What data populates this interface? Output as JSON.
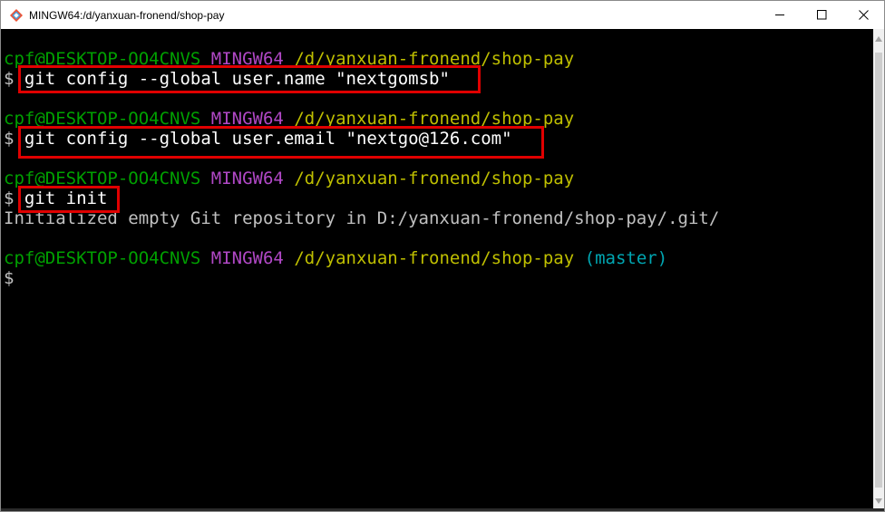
{
  "window": {
    "title": "MINGW64:/d/yanxuan-fronend/shop-pay",
    "icon": "git-bash-icon",
    "controls": [
      "minimize-icon",
      "maximize-icon",
      "close-icon"
    ]
  },
  "colors": {
    "user_host": "#00a000",
    "system": "#b148c6",
    "path": "#bfbf00",
    "branch": "#00a6b2",
    "highlight": "#e00000"
  },
  "terminal": {
    "blocks": [
      {
        "user_host": "cpf@DESKTOP-OO4CNVS",
        "system": "MINGW64",
        "path": "/d/yanxuan-fronend/shop-pay",
        "prompt": "$",
        "command": "git config --global user.name \"nextgomsb\""
      },
      {
        "user_host": "cpf@DESKTOP-OO4CNVS",
        "system": "MINGW64",
        "path": "/d/yanxuan-fronend/shop-pay",
        "prompt": "$",
        "command": "git config --global user.email \"nextgo@126.com\""
      },
      {
        "user_host": "cpf@DESKTOP-OO4CNVS",
        "system": "MINGW64",
        "path": "/d/yanxuan-fronend/shop-pay",
        "prompt": "$",
        "command": "git init",
        "output": "Initialized empty Git repository in D:/yanxuan-fronend/shop-pay/.git/"
      },
      {
        "user_host": "cpf@DESKTOP-OO4CNVS",
        "system": "MINGW64",
        "path": "/d/yanxuan-fronend/shop-pay",
        "branch": "(master)",
        "prompt": "$",
        "command": ""
      }
    ]
  }
}
